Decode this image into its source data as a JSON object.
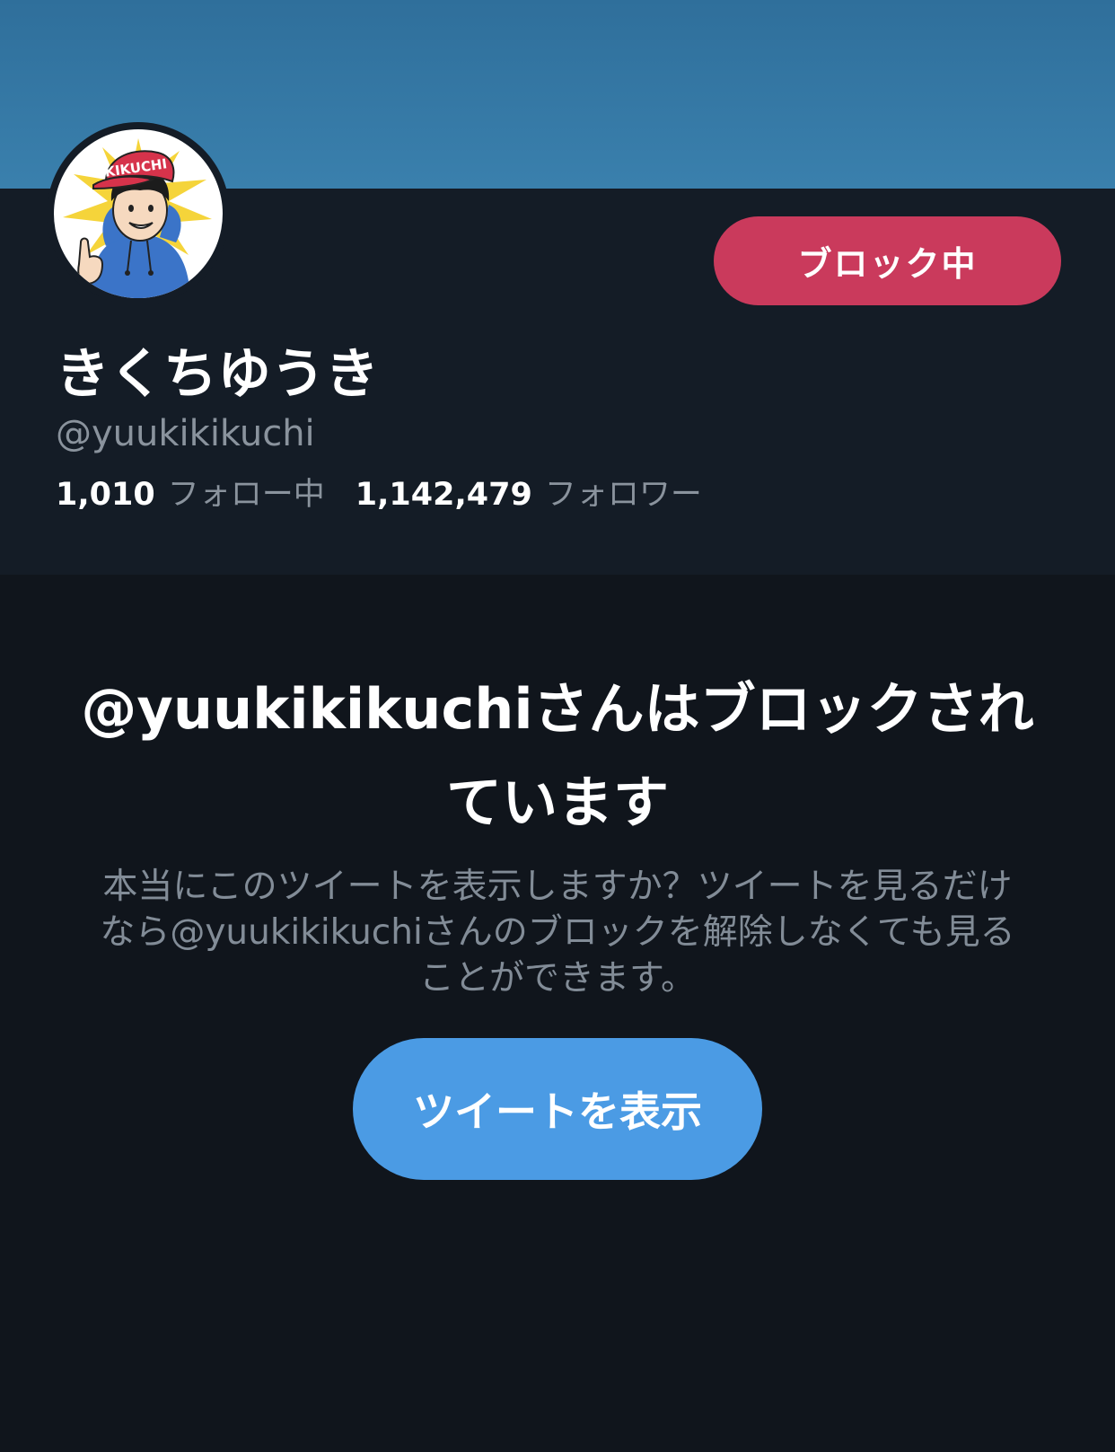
{
  "profile": {
    "display_name": "きくちゆうき",
    "handle": "@yuukikikuchi",
    "following_count": "1,010",
    "following_label": "フォロー中",
    "followers_count": "1,142,479",
    "followers_label": "フォロワー",
    "avatar_cap_text": "KIKUCHI",
    "block_button_label": "ブロック中"
  },
  "blocked_notice": {
    "title": "@yuukikikuchiさんはブロックされています",
    "description": "本当にこのツイートを表示しますか？ツイートを見るだけなら@yuukikikuchiさんのブロックを解除しなくても見ることができます。",
    "show_button_label": "ツイートを表示"
  },
  "colors": {
    "banner": "#3a80ad",
    "profile_bg": "#141c26",
    "page_bg": "#10151c",
    "block_button": "#ca3a5c",
    "show_button": "#4b9be4"
  }
}
